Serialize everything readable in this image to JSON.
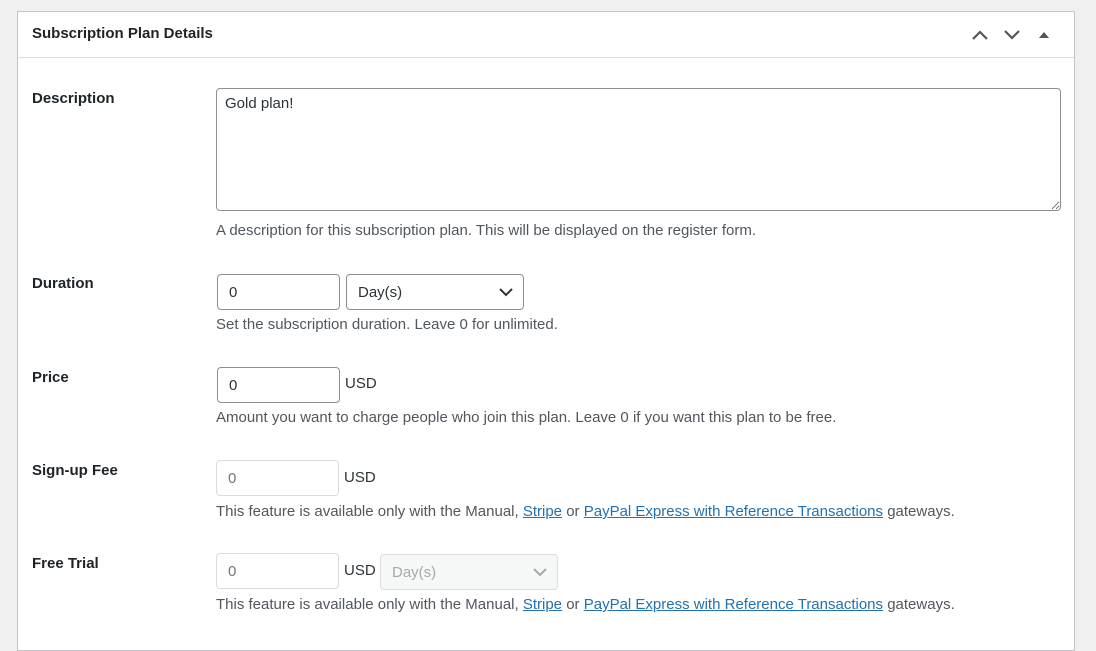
{
  "panel": {
    "title": "Subscription Plan Details"
  },
  "icons": {
    "move_up": "chevron-up-icon",
    "move_down": "chevron-down-icon",
    "toggle": "triangle-up-icon"
  },
  "fields": {
    "description": {
      "label": "Description",
      "value": "Gold plan!",
      "help": "A description for this subscription plan. This will be displayed on the register form."
    },
    "duration": {
      "label": "Duration",
      "value": "0",
      "unit": "Day(s)",
      "help": "Set the subscription duration. Leave 0 for unlimited."
    },
    "price": {
      "label": "Price",
      "value": "0",
      "currency": "USD",
      "help": "Amount you want to charge people who join this plan. Leave 0 if you want this plan to be free."
    },
    "signup_fee": {
      "label": "Sign-up Fee",
      "placeholder": "0",
      "currency": "USD",
      "help_prefix": "This feature is available only with the Manual,",
      "link1": "Stripe",
      "help_mid": "or",
      "link2": "PayPal Express with Reference Transactions",
      "help_suffix": "gateways."
    },
    "free_trial": {
      "label": "Free Trial",
      "placeholder": "0",
      "currency": "USD",
      "unit": "Day(s)",
      "help_prefix": "This feature is available only with the Manual,",
      "link1": "Stripe",
      "help_mid": "or",
      "link2": "PayPal Express with Reference Transactions",
      "help_suffix": "gateways."
    }
  },
  "colors": {
    "link": "#2271b1",
    "border": "#8c8f94",
    "disabled_border": "#dcdcde"
  }
}
